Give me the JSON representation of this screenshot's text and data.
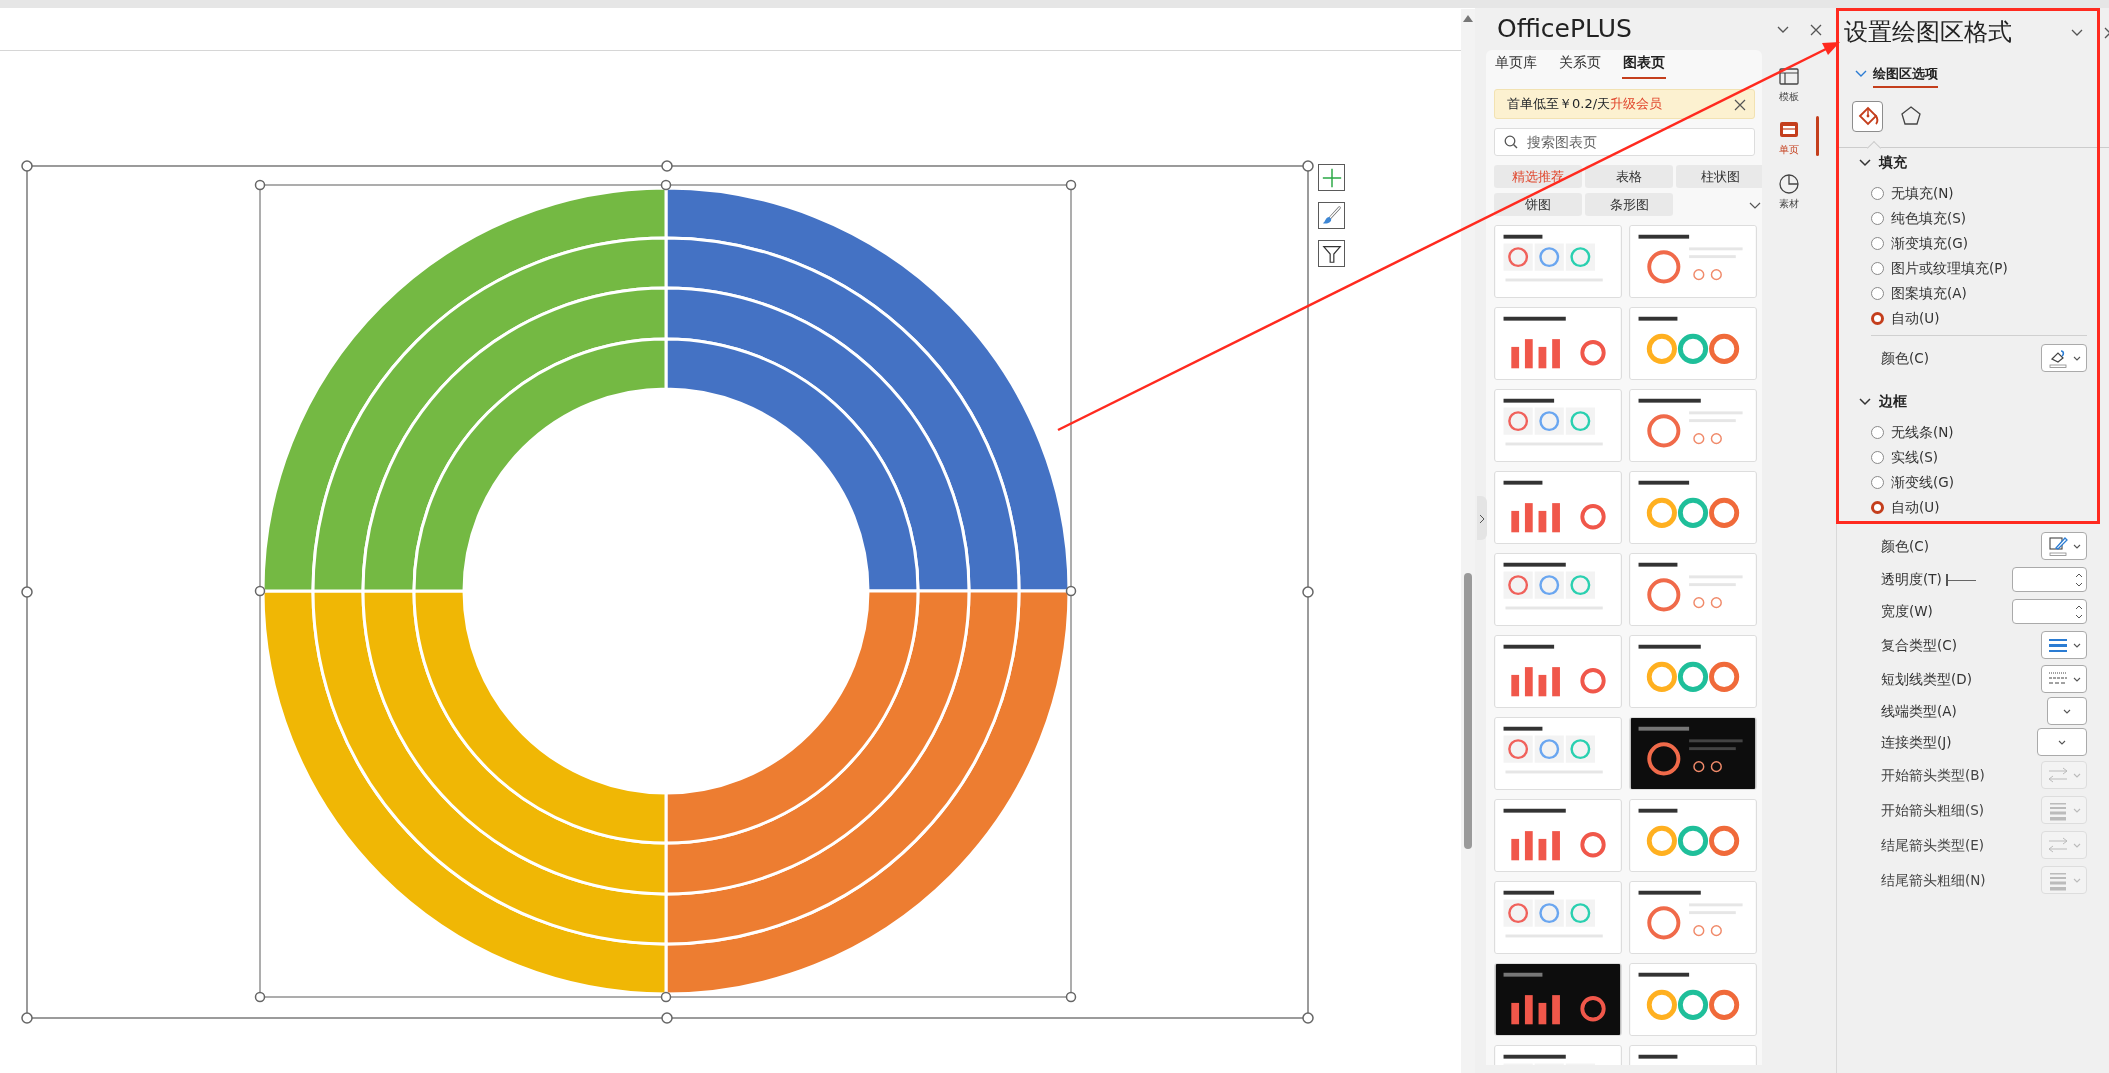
{
  "officeplus": {
    "title": "OfficePLUS",
    "tabs": [
      {
        "label": "单页库",
        "selected": false
      },
      {
        "label": "关系页",
        "selected": false
      },
      {
        "label": "图表页",
        "selected": true
      }
    ],
    "promo": {
      "text": "首单低至￥0.2/天",
      "link": "升级会员"
    },
    "search": {
      "placeholder": "搜索图表页"
    },
    "filters": [
      {
        "label": "精选推荐",
        "selected": true
      },
      {
        "label": "表格",
        "selected": false
      },
      {
        "label": "柱状图",
        "selected": false
      },
      {
        "label": "饼图",
        "selected": false
      },
      {
        "label": "条形图",
        "selected": false
      }
    ],
    "thumbnails": [
      {
        "kind": "picture",
        "dark": false
      },
      {
        "kind": "picture",
        "dark": false
      },
      {
        "kind": "picture",
        "dark": false
      },
      {
        "kind": "picture",
        "dark": false
      },
      {
        "kind": "picture",
        "dark": false
      },
      {
        "kind": "picture",
        "dark": false
      },
      {
        "kind": "picture",
        "dark": false
      },
      {
        "kind": "picture",
        "dark": false
      },
      {
        "kind": "picture",
        "dark": false
      },
      {
        "kind": "picture",
        "dark": false
      },
      {
        "kind": "picture",
        "dark": false
      },
      {
        "kind": "picture",
        "dark": false
      },
      {
        "kind": "picture",
        "dark": false
      },
      {
        "kind": "picture",
        "dark": true
      },
      {
        "kind": "picture",
        "dark": false
      },
      {
        "kind": "picture",
        "dark": false
      },
      {
        "kind": "picture",
        "dark": false
      },
      {
        "kind": "picture",
        "dark": false
      },
      {
        "kind": "picture",
        "dark": true
      },
      {
        "kind": "picture",
        "dark": false
      },
      {
        "kind": "picture",
        "dark": false
      },
      {
        "kind": "picture",
        "dark": false
      }
    ],
    "side_tabs": [
      {
        "kind": "template",
        "label": "模板",
        "selected": false
      },
      {
        "kind": "page",
        "label": "单页",
        "selected": true
      },
      {
        "kind": "material",
        "label": "素材",
        "selected": false
      }
    ]
  },
  "format_pane": {
    "title": "设置绘图区格式",
    "section_tab": {
      "label": "绘图区选项",
      "expanded": true
    },
    "icon_tabs": [
      {
        "kind": "fill",
        "selected": true
      },
      {
        "kind": "shape",
        "selected": false
      }
    ],
    "fill": {
      "title": "填充",
      "expanded": true,
      "options": [
        {
          "label": "无填充(N)",
          "selected": false
        },
        {
          "label": "纯色填充(S)",
          "selected": false
        },
        {
          "label": "渐变填充(G)",
          "selected": false
        },
        {
          "label": "图片或纹理填充(P)",
          "selected": false
        },
        {
          "label": "图案填充(A)",
          "selected": false
        },
        {
          "label": "自动(U)",
          "selected": true
        }
      ],
      "color_label": "颜色(C)"
    },
    "border": {
      "title": "边框",
      "expanded": true,
      "options": [
        {
          "label": "无线条(N)",
          "selected": false
        },
        {
          "label": "实线(S)",
          "selected": false
        },
        {
          "label": "渐变线(G)",
          "selected": false
        },
        {
          "label": "自动(U)",
          "selected": true
        }
      ],
      "properties": [
        {
          "kind": "color",
          "label": "颜色(C)",
          "disabled": false
        },
        {
          "kind": "slider",
          "label": "透明度(T)",
          "disabled": false,
          "level": 0
        },
        {
          "kind": "spinner",
          "label": "宽度(W)",
          "disabled": false
        },
        {
          "kind": "compound",
          "label": "复合类型(C)",
          "disabled": false
        },
        {
          "kind": "dash",
          "label": "短划线类型(D)",
          "disabled": false
        },
        {
          "kind": "dropdown",
          "label": "线端类型(A)",
          "disabled": false
        },
        {
          "kind": "dropdown",
          "label": "连接类型(J)",
          "disabled": false
        },
        {
          "kind": "arrow-type",
          "label": "开始箭头类型(B)",
          "disabled": true
        },
        {
          "kind": "arrow-size",
          "label": "开始箭头粗细(S)",
          "disabled": true
        },
        {
          "kind": "arrow-type",
          "label": "结尾箭头类型(E)",
          "disabled": true
        },
        {
          "kind": "arrow-size",
          "label": "结尾箭头粗细(N)",
          "disabled": true
        }
      ]
    }
  }
}
